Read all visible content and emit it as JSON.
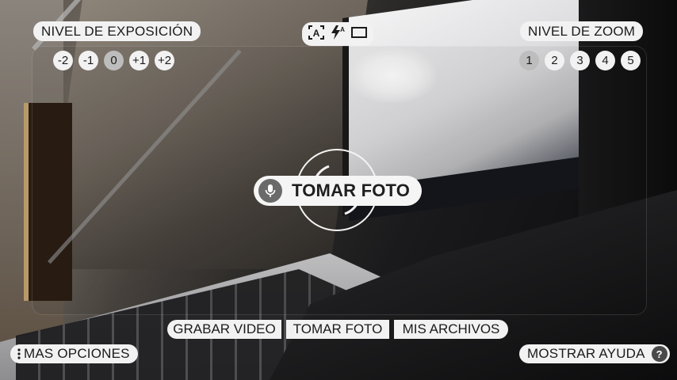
{
  "exposure": {
    "title": "NIVEL DE EXPOSICIÓN",
    "levels": [
      "-2",
      "-1",
      "0",
      "+1",
      "+2"
    ],
    "selected": "0"
  },
  "zoom": {
    "title": "NIVEL DE ZOOM",
    "levels": [
      "1",
      "2",
      "3",
      "4",
      "5"
    ],
    "selected": "1"
  },
  "top_icons": [
    "auto-focus-icon",
    "flash-auto-icon",
    "aspect-ratio-icon"
  ],
  "center": {
    "label": "TOMAR FOTO",
    "icon": "microphone-icon"
  },
  "bottom_buttons": {
    "record_video": "GRABAR VIDEO",
    "take_photo": "TOMAR FOTO",
    "my_files": "MIS ARCHIVOS"
  },
  "more_options": "MAS OPCIONES",
  "show_help": "MOSTRAR AYUDA",
  "help_glyph": "?",
  "colors": {
    "pill_bg": "#f2f2f2",
    "pill_text": "#1b1b1b",
    "selected_level": "#bdbdbd",
    "mic_bg": "#6a6a6a"
  }
}
